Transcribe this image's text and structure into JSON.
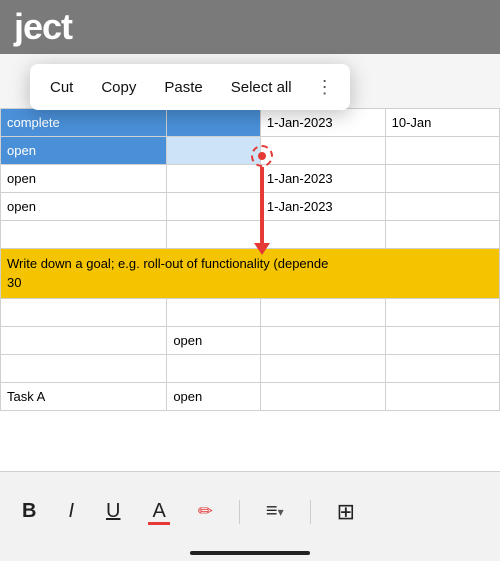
{
  "header": {
    "title": "ject"
  },
  "context_menu": {
    "items": [
      "Cut",
      "Copy",
      "Paste",
      "Select all"
    ]
  },
  "spreadsheet": {
    "rows": [
      {
        "col_a": "complete",
        "col_b": "",
        "col_c": "1-Jan-2023",
        "col_d": "10-Jan",
        "selected": true
      },
      {
        "col_a": "open",
        "col_b": "",
        "col_c": "",
        "col_d": "",
        "selected": false
      },
      {
        "col_a": "open",
        "col_b": "",
        "col_c": "1-Jan-2023",
        "col_d": "",
        "selected": false
      },
      {
        "col_a": "open",
        "col_b": "",
        "col_c": "1-Jan-2023",
        "col_d": "",
        "selected": false
      },
      {
        "col_a": "",
        "col_b": "",
        "col_c": "",
        "col_d": "",
        "selected": false
      },
      {
        "col_a": "",
        "col_b": "",
        "col_c": "",
        "col_d": "",
        "hint": true,
        "hint_text": "Write down a goal; e.g. roll-out of functionality (depende\n30"
      },
      {
        "col_a": "",
        "col_b": "",
        "col_c": "",
        "col_d": "",
        "selected": false
      },
      {
        "col_a": "",
        "col_b": "open",
        "col_c": "",
        "col_d": "",
        "selected": false
      },
      {
        "col_a": "",
        "col_b": "",
        "col_c": "",
        "col_d": "",
        "selected": false
      },
      {
        "col_a": "Task A",
        "col_b": "open",
        "col_c": "",
        "col_d": "",
        "selected": false
      }
    ]
  },
  "toolbar": {
    "bold_label": "B",
    "italic_label": "I",
    "underline_label": "U",
    "font_color_label": "A",
    "pencil_label": "✏",
    "align_label": "≡",
    "insert_label": "⊞"
  }
}
